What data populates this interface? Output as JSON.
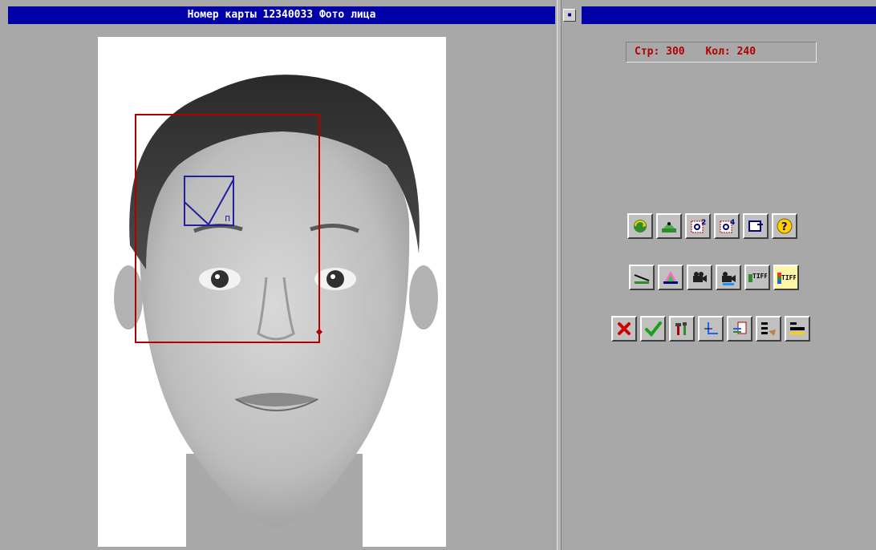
{
  "window": {
    "title": "Номер карты 12340033 Фото лица",
    "sys_button": "▪"
  },
  "status": {
    "page_label": "Стр: 300",
    "count_label": "Кол: 240"
  },
  "colors": {
    "titlebar": "#0000a8",
    "panel": "#a8a8a8",
    "selection": "#b00000",
    "marker": "#2020a0"
  },
  "toolbar_rows": [
    [
      "rotate-icon",
      "scanner-icon",
      "zoom-2x-icon",
      "zoom-4x-icon",
      "export-icon",
      "help-icon"
    ],
    [
      "scan-line-icon",
      "scan-color-icon",
      "camera-icon",
      "camera-color-icon",
      "tiff-icon",
      "tiff-color-icon"
    ],
    [
      "cancel-icon",
      "ok-icon",
      "tools-icon",
      "angle-icon",
      "adjust-icon",
      "settings-icon",
      "levels-icon"
    ]
  ],
  "tiff_text": "TIFF",
  "marker_label": "п"
}
